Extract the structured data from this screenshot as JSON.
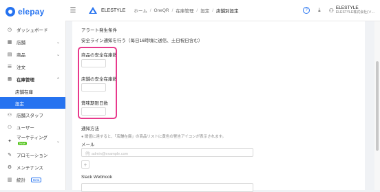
{
  "sidebar": {
    "logo_text": "elepay",
    "items": [
      {
        "icon": "◷",
        "label": "ダッシュボード",
        "has_arrow": false
      },
      {
        "icon": "▦",
        "label": "店舗",
        "has_arrow": true
      },
      {
        "icon": "▤",
        "label": "商品",
        "has_arrow": true
      },
      {
        "icon": "☰",
        "label": "注文",
        "has_arrow": false
      }
    ],
    "inventory": {
      "icon": "⊞",
      "label": "在庫管理"
    },
    "inventory_sub": [
      "店舗在庫",
      "設定"
    ],
    "items_after": [
      {
        "icon": "⚇",
        "label": "店舗スタッフ"
      },
      {
        "icon": "⚇",
        "label": "ユーザー"
      }
    ],
    "marketing": {
      "icon": "✦",
      "label": "マーケティング",
      "badge": "New"
    },
    "items_bottom": [
      {
        "icon": "✎",
        "label": "プロモーション"
      },
      {
        "icon": "⚙",
        "label": "メンテナンス"
      }
    ],
    "stats": {
      "icon": "▥",
      "label": "統計",
      "badge": "Beta"
    }
  },
  "header": {
    "app_name": "ELESTYLE",
    "breadcrumb": [
      "ホーム",
      "OneQR",
      "在庫管理",
      "設定",
      "店舗別設定"
    ],
    "user_name": "ELESTYLE",
    "user_company": "ELESTYLE株式会社(ソ..."
  },
  "form": {
    "section_title": "アラート発生条件",
    "schedule_text": "安全ライン通知を行う（毎日16時頃に送信、土日祝日含む）",
    "product_stock_label": "商品の安全在庫数",
    "store_stock_label": "店舗の安全在庫数",
    "expiry_label": "賞味期限日数",
    "notify_title": "通知方法",
    "notify_hint": "● 閾値に達すると、「店舗在庫」の商品リストに黄色の警告アイコンが表示されます。",
    "email_label": "メール",
    "email_placeholder": "例) admin@example.com",
    "add_button": "+",
    "slack_label": "Slack Webhook"
  }
}
